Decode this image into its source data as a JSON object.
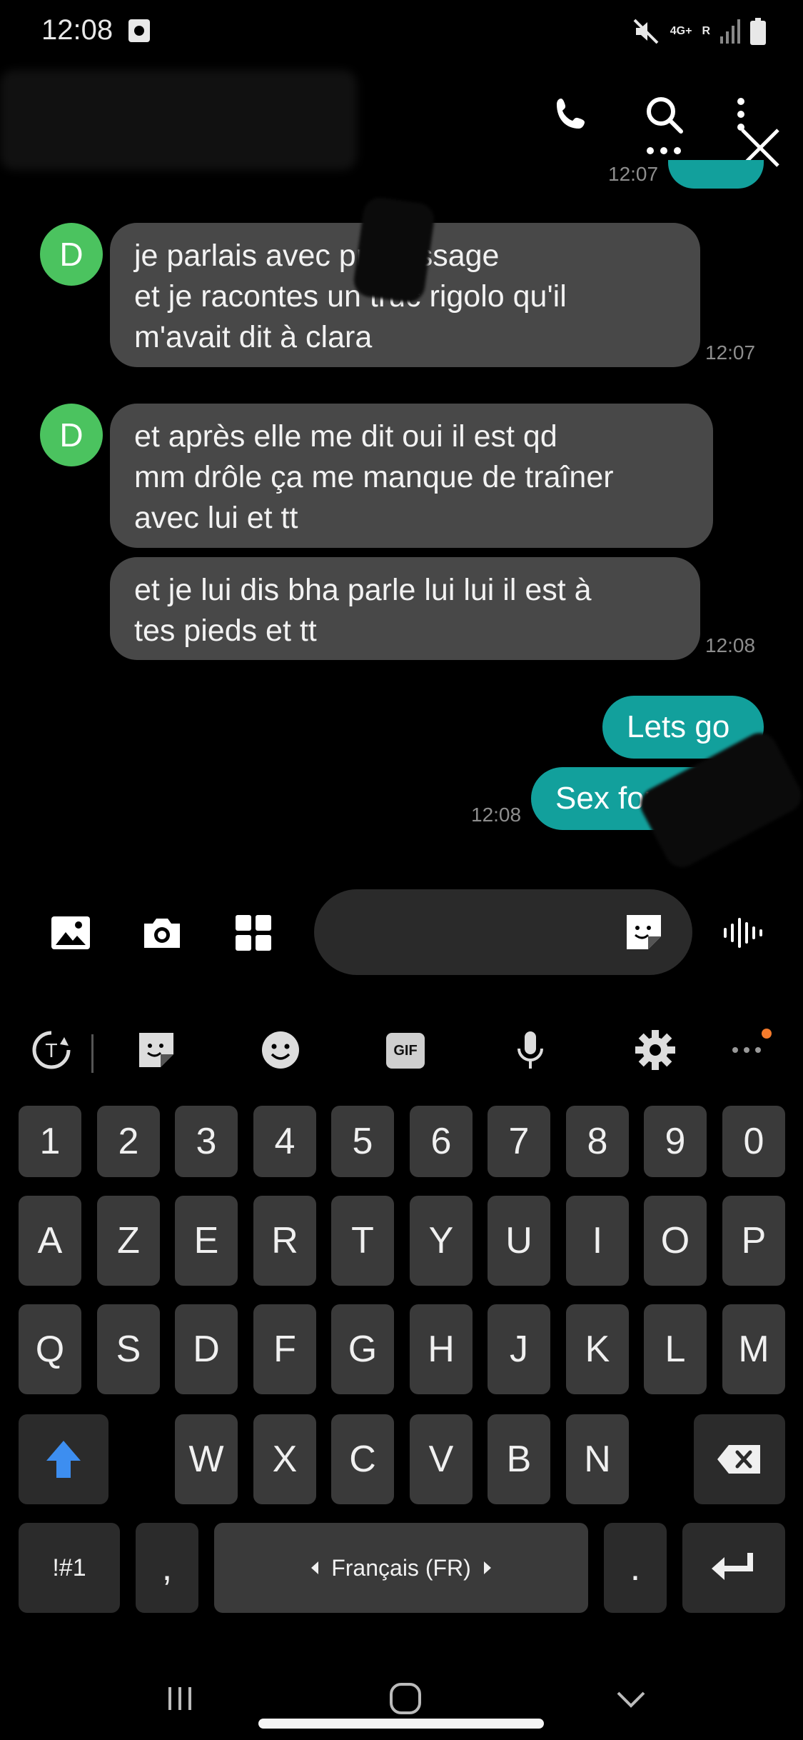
{
  "status_bar": {
    "time": "12:08",
    "network": "4G+",
    "roaming": "R",
    "icons": [
      "notification-icon",
      "mute-icon",
      "signal-icon",
      "battery-icon"
    ]
  },
  "app_bar": {
    "icons": [
      "phone-icon",
      "search-icon",
      "more-vert-icon",
      "close-icon"
    ]
  },
  "conversation": {
    "peek_time": "12:07",
    "messages": [
      {
        "direction": "in",
        "avatar": "D",
        "text": "je parlais avec       pr message\net je racontes un truc rigolo qu'il\nm'avait dit à clara",
        "time": "12:07"
      },
      {
        "direction": "in",
        "avatar": "D",
        "text": "et après elle me dit oui il est qd\nmm drôle ça me manque de traîner\navec lui et tt",
        "time": ""
      },
      {
        "direction": "in",
        "avatar": "",
        "text": "et je lui dis bha parle lui lui il est à\ntes pieds et tt",
        "time": "12:08"
      },
      {
        "direction": "out",
        "text": "Lets go",
        "time": ""
      },
      {
        "direction": "out",
        "text": "Sex for",
        "time": "12:08"
      }
    ]
  },
  "composer": {
    "icons": [
      "gallery-icon",
      "camera-icon",
      "apps-grid-icon",
      "sticker-icon",
      "voice-wave-icon"
    ],
    "placeholder": ""
  },
  "keyboard": {
    "toolbar_icons": [
      "translate-icon",
      "sticker-icon",
      "emoji-icon",
      "gif-icon",
      "mic-icon",
      "settings-icon",
      "more-icon"
    ],
    "gif_label": "GIF",
    "accent_color": "#3d8ef0",
    "rows": {
      "numbers": [
        "1",
        "2",
        "3",
        "4",
        "5",
        "6",
        "7",
        "8",
        "9",
        "0"
      ],
      "row1": [
        "A",
        "Z",
        "E",
        "R",
        "T",
        "Y",
        "U",
        "I",
        "O",
        "P"
      ],
      "row2": [
        "Q",
        "S",
        "D",
        "F",
        "G",
        "H",
        "J",
        "K",
        "L",
        "M"
      ],
      "row3": [
        "W",
        "X",
        "C",
        "V",
        "B",
        "N"
      ]
    },
    "symbols_label": "!#1",
    "comma_label": ",",
    "space_label": "Français (FR)",
    "period_label": "."
  },
  "nav_bar": {
    "icons": [
      "recents-icon",
      "home-icon",
      "back-icon"
    ]
  },
  "colors": {
    "outgoing_bubble": "#12a09c",
    "incoming_bubble": "#484848",
    "avatar": "#4bc35f"
  }
}
